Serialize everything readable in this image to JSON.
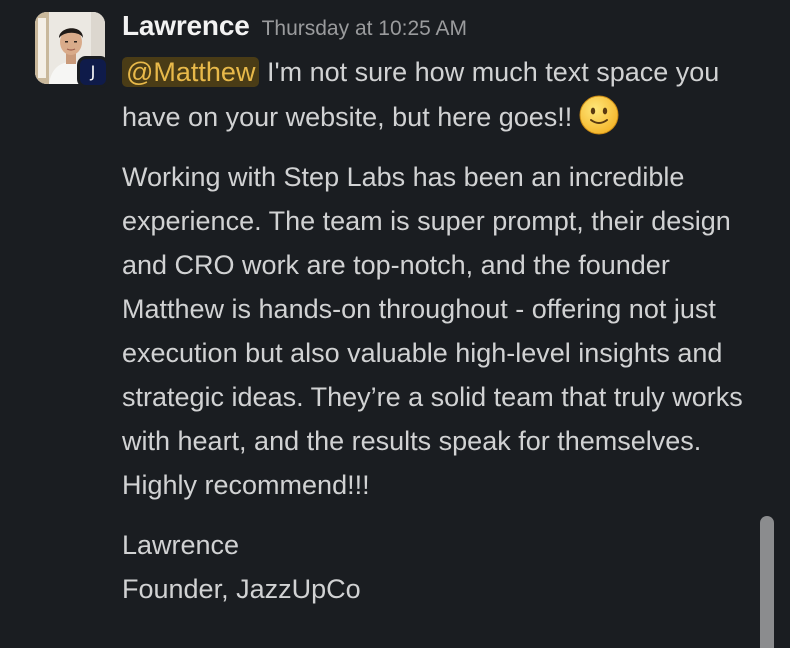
{
  "message": {
    "sender": "Lawrence",
    "timestamp": "Thursday at 10:25 AM",
    "workspace_badge": "J",
    "mention": "@Matthew",
    "intro_text": " I'm not sure how much text space you have on your website, but here goes!!",
    "emoji_name": "slightly-smiling-face",
    "testimonial": "Working with Step Labs has been an incredible experience. The team is super prompt, their design and CRO work are top-notch, and the founder Matthew is hands-on throughout - offering not just execution but also valuable high-level insights and strategic ideas. They’re a solid team that truly works with heart, and the results speak for themselves. Highly recommend!!!",
    "signature_name": "Lawrence",
    "signature_title": "Founder, JazzUpCo"
  },
  "colors": {
    "background": "#1a1d21",
    "text": "#d1d2d3",
    "mention_bg": "#4a3c16",
    "mention_text": "#e8b94a",
    "badge_bg": "#0f1b4a"
  }
}
